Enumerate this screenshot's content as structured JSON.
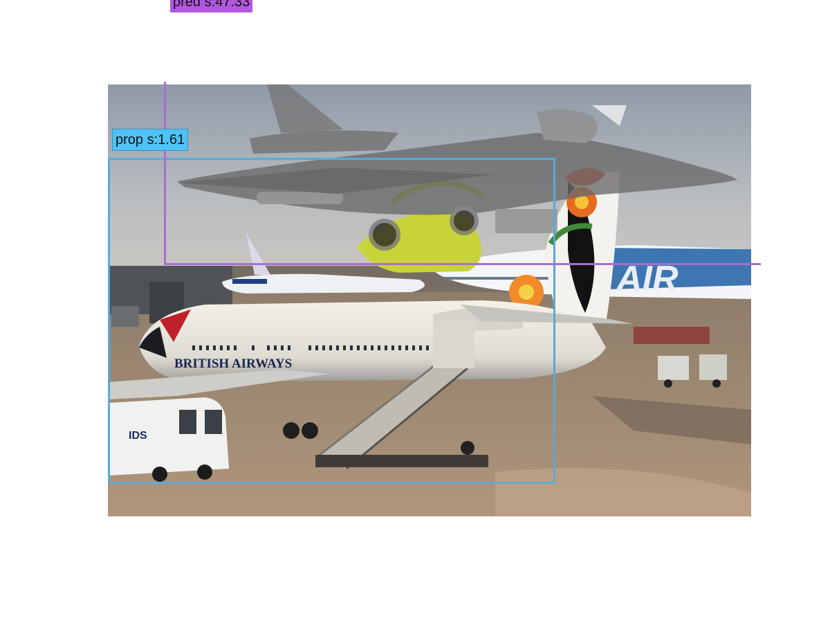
{
  "annotations": {
    "proposal": {
      "label": "prop s:1.61",
      "color": "#4fc3f7"
    },
    "prediction": {
      "label": "pred s:47.33",
      "color": "#b257e0"
    }
  },
  "scene": {
    "livery_text": "BRITISH AIRWAYS",
    "tail_text": "AIR",
    "van_text": "IDS"
  }
}
